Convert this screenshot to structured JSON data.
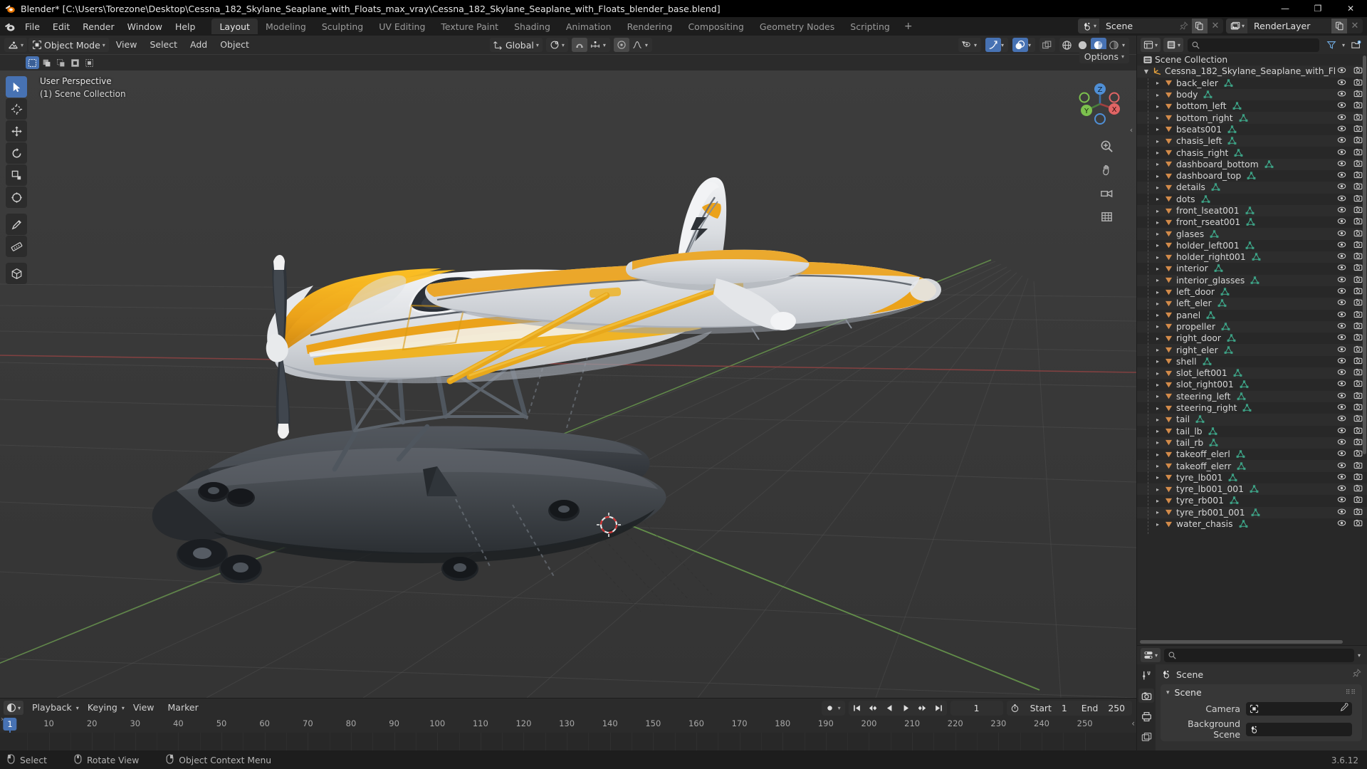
{
  "window": {
    "title": "Blender* [C:\\Users\\Torezone\\Desktop\\Cessna_182_Skylane_Seaplane_with_Floats_max_vray\\Cessna_182_Skylane_Seaplane_with_Floats_blender_base.blend]",
    "minimize": "—",
    "maximize": "❐",
    "close": "✕"
  },
  "topbar": {
    "menus": [
      "File",
      "Edit",
      "Render",
      "Window",
      "Help"
    ],
    "workspaces": [
      {
        "label": "Layout",
        "active": true
      },
      {
        "label": "Modeling",
        "active": false
      },
      {
        "label": "Sculpting",
        "active": false
      },
      {
        "label": "UV Editing",
        "active": false
      },
      {
        "label": "Texture Paint",
        "active": false
      },
      {
        "label": "Shading",
        "active": false
      },
      {
        "label": "Animation",
        "active": false
      },
      {
        "label": "Rendering",
        "active": false
      },
      {
        "label": "Compositing",
        "active": false
      },
      {
        "label": "Geometry Nodes",
        "active": false
      },
      {
        "label": "Scripting",
        "active": false
      }
    ],
    "add_workspace": "+",
    "scene_name": "Scene",
    "viewlayer_name": "RenderLayer"
  },
  "viewport": {
    "mode": "Object Mode",
    "menus": [
      "View",
      "Select",
      "Add",
      "Object"
    ],
    "transform_orientation": "Global",
    "overlay_line1": "User Perspective",
    "overlay_line2": "(1) Scene Collection",
    "options_label": "Options",
    "gizmo_axes": {
      "x": "X",
      "y": "Y",
      "z": "Z"
    },
    "background_color": "#393939",
    "grid_color": "#4a4a4a",
    "axis_x_color": "#a33b3b",
    "axis_y_color": "#54a33b",
    "accent_blue": "#4772b3"
  },
  "outliner": {
    "search_placeholder": "",
    "scene_collection": "Scene Collection",
    "root_object": "Cessna_182_Skylane_Seaplane_with_Fl",
    "items": [
      "back_eler",
      "body",
      "bottom_left",
      "bottom_right",
      "bseats001",
      "chasis_left",
      "chasis_right",
      "dashboard_bottom",
      "dashboard_top",
      "details",
      "dots",
      "front_lseat001",
      "front_rseat001",
      "glases",
      "holder_left001",
      "holder_right001",
      "interior",
      "interior_glasses",
      "left_door",
      "left_eler",
      "panel",
      "propeller",
      "right_door",
      "right_eler",
      "shell",
      "slot_left001",
      "slot_right001",
      "steering_left",
      "steering_right",
      "tail",
      "tail_lb",
      "tail_rb",
      "takeoff_elerl",
      "takeoff_elerr",
      "tyre_lb001",
      "tyre_lb001_001",
      "tyre_rb001",
      "tyre_rb001_001",
      "water_chasis"
    ]
  },
  "properties": {
    "breadcrumb": "Scene",
    "panel_title": "Scene",
    "rows": [
      {
        "label": "Camera",
        "value": ""
      },
      {
        "label": "Background Scene",
        "value": ""
      }
    ]
  },
  "timeline": {
    "menus": [
      "Playback",
      "Keying",
      "View",
      "Marker"
    ],
    "current_frame": "1",
    "start_label": "Start",
    "start_value": "1",
    "end_label": "End",
    "end_value": "250",
    "ticks": [
      10,
      20,
      30,
      40,
      50,
      60,
      70,
      80,
      90,
      100,
      110,
      120,
      130,
      140,
      150,
      160,
      170,
      180,
      190,
      200,
      210,
      220,
      230,
      240,
      250
    ],
    "playhead_frame": "1"
  },
  "statusbar": {
    "hints": [
      {
        "icon": "mouse-left-icon",
        "label": "Select"
      },
      {
        "icon": "mouse-middle-icon",
        "label": "Rotate View"
      },
      {
        "icon": "mouse-right-icon",
        "label": "Object Context Menu"
      }
    ],
    "version": "3.6.12"
  }
}
